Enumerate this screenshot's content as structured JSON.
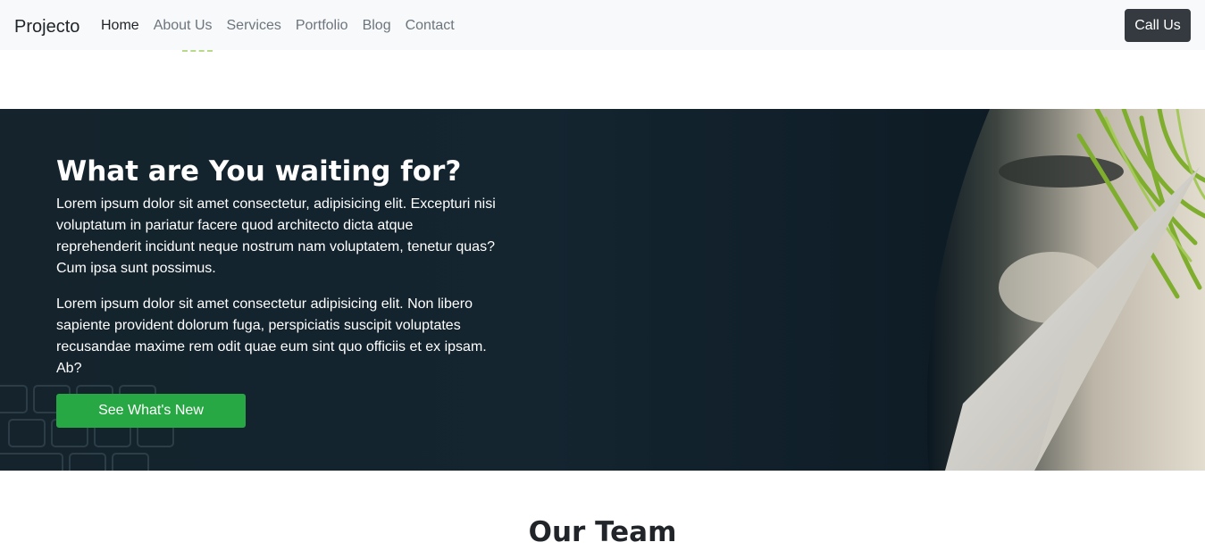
{
  "navbar": {
    "brand": "Projecto",
    "links": [
      {
        "label": "Home",
        "active": true
      },
      {
        "label": "About Us",
        "active": false
      },
      {
        "label": "Services",
        "active": false
      },
      {
        "label": "Portfolio",
        "active": false
      },
      {
        "label": "Blog",
        "active": false
      },
      {
        "label": "Contact",
        "active": false
      }
    ],
    "cta_label": "Call Us"
  },
  "cta_section": {
    "title": "What are You waiting for?",
    "paragraphs": [
      "Lorem ipsum dolor sit amet consectetur, adipisicing elit. Excepturi nisi voluptatum in pariatur facere quod architecto dicta atque reprehenderit incidunt neque nostrum nam voluptatem, tenetur quas? Cum ipsa sunt possimus.",
      "Lorem ipsum dolor sit amet consectetur adipisicing elit. Non libero sapiente provident dolorum fuga, perspiciatis suscipit voluptates recusandae maxime rem odit quae eum sint quo officiis et ex ipsam. Ab?"
    ],
    "button_label": "See What's New"
  },
  "team": {
    "title": "Our Team"
  },
  "colors": {
    "navbar_bg": "#f8f9fa",
    "nav_active": "#212529",
    "nav_inactive": "#6c757d",
    "call_button_bg": "#343a40",
    "cta_bg": "#142530",
    "cta_button_bg": "#28a745"
  },
  "icons": {
    "cta_image": "paper-airplane-plant-photo"
  }
}
